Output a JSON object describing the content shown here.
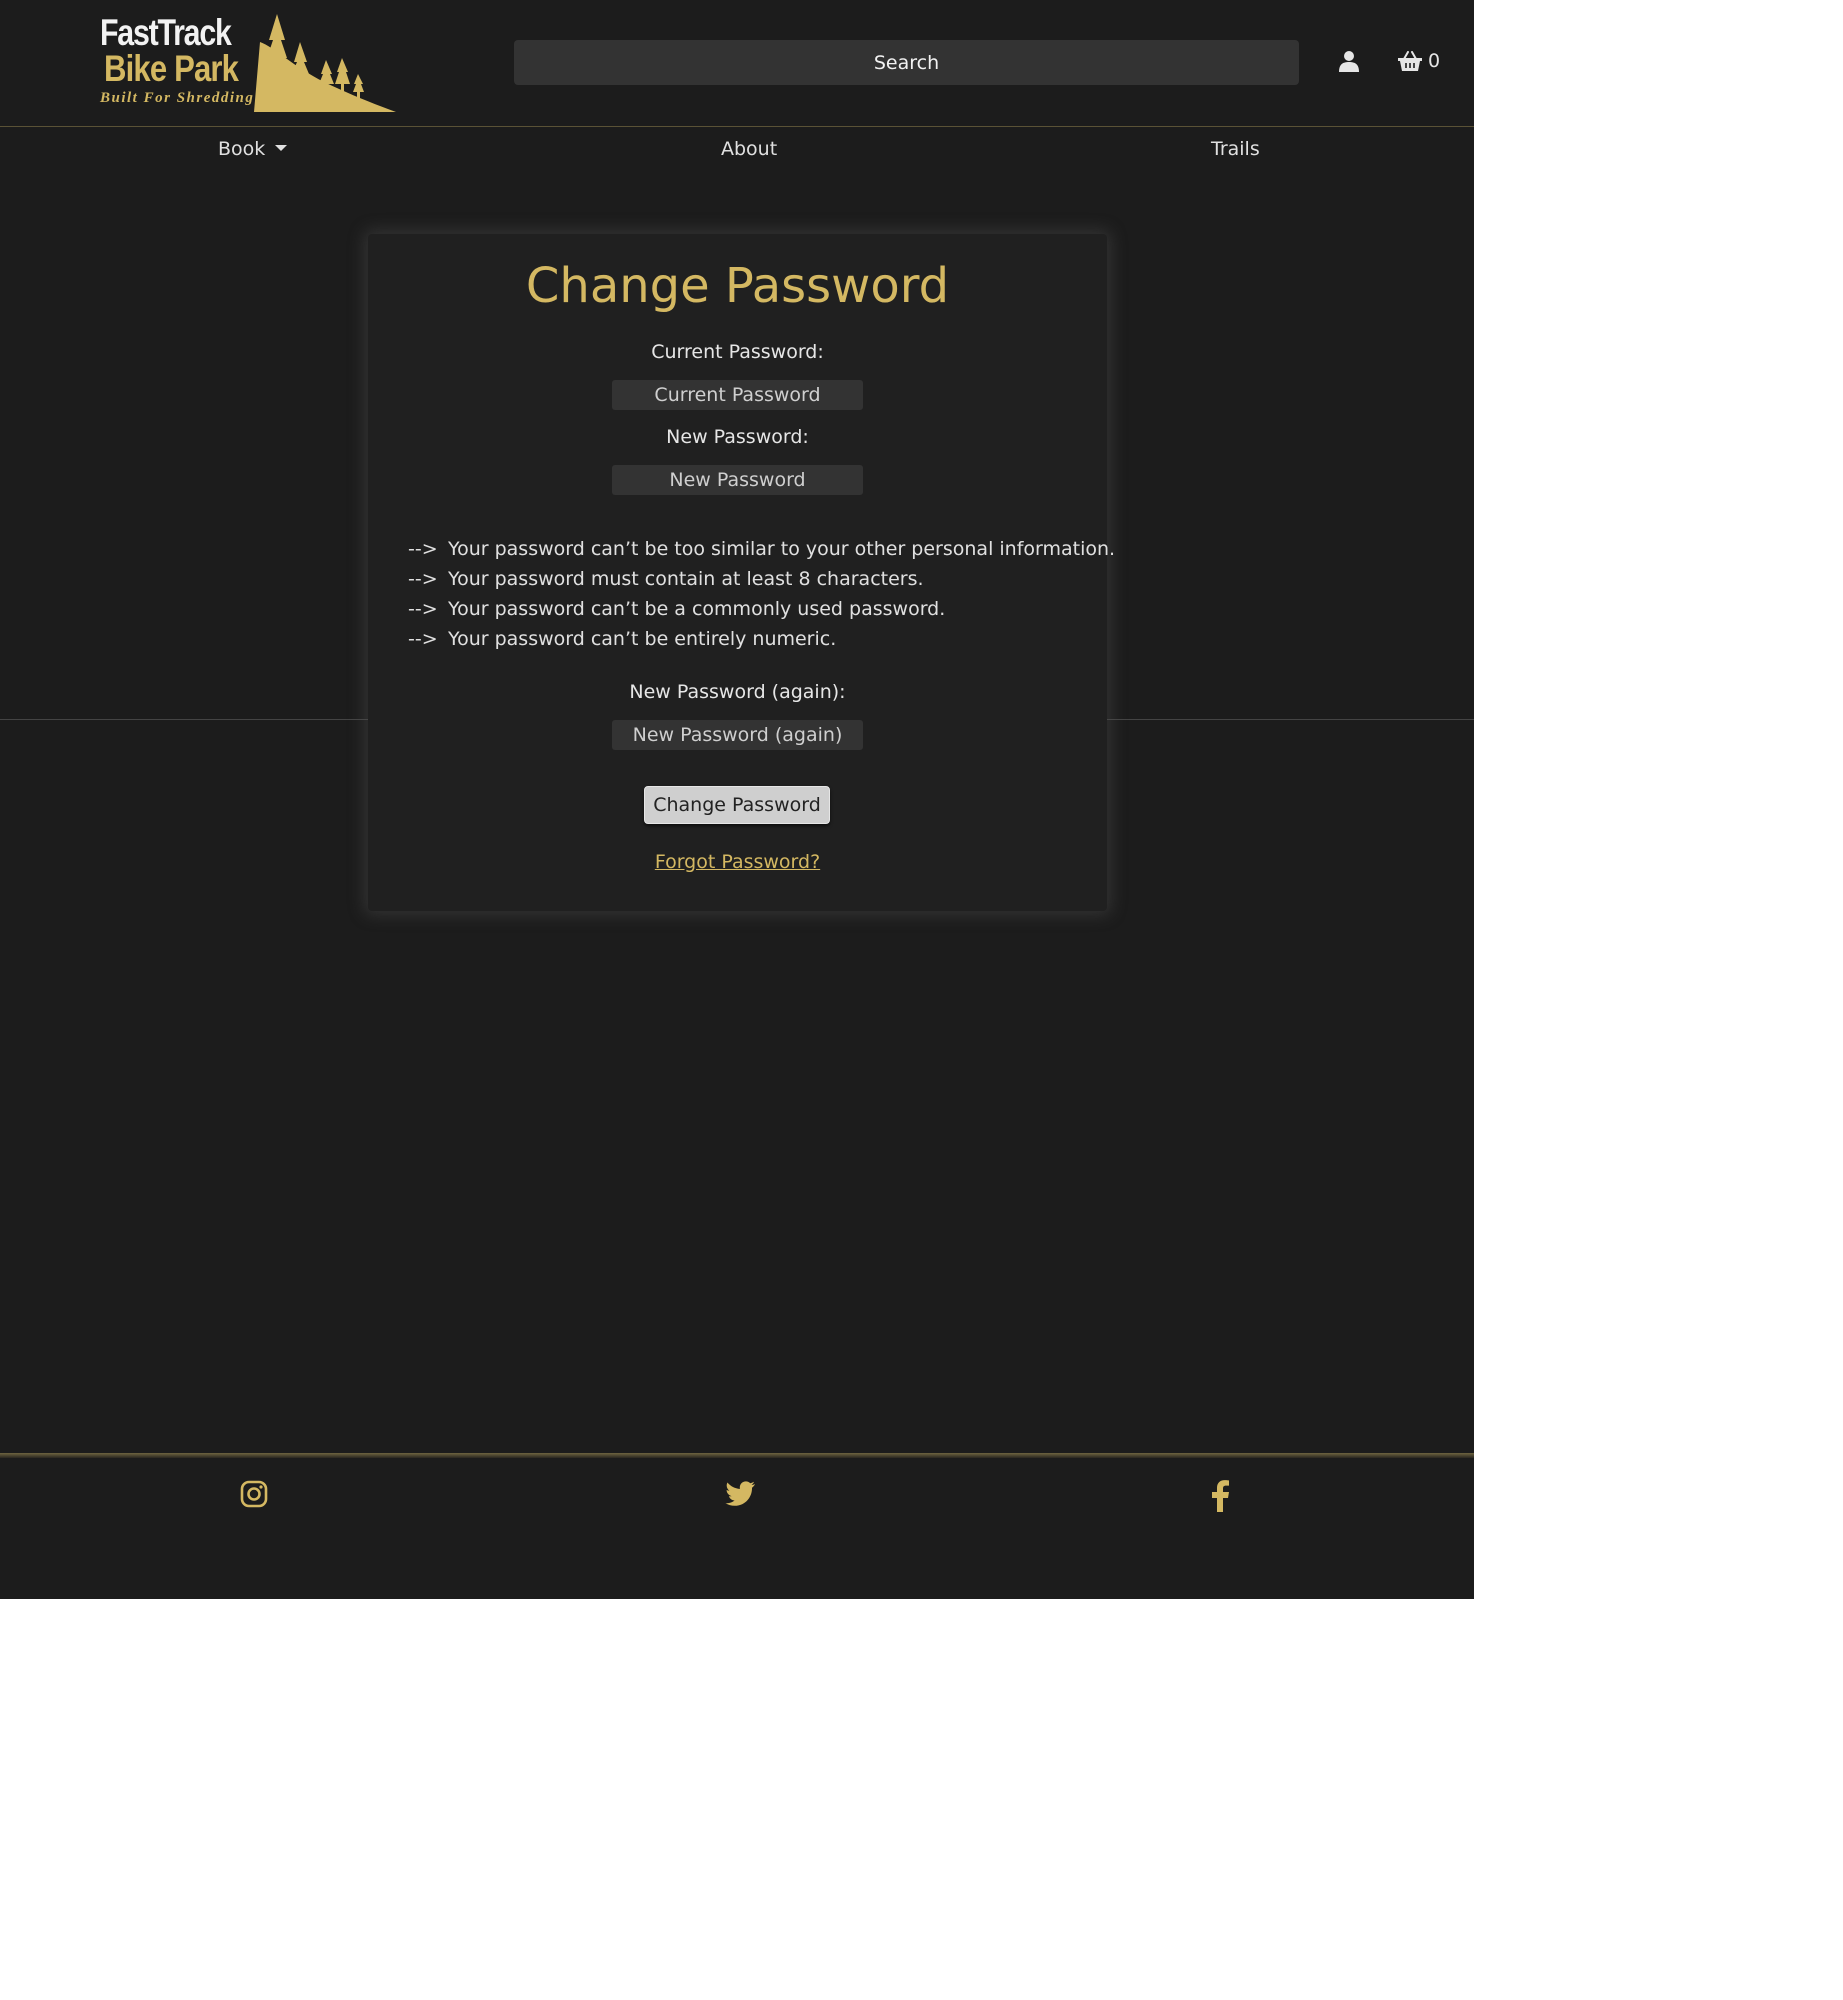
{
  "brand": {
    "line1": "FastTrack",
    "line2": "Bike Park",
    "tagline": "Built For Shredding",
    "accent_color": "#d4b862"
  },
  "header": {
    "search_placeholder": "Search",
    "account_icon": "user-icon",
    "cart_icon": "basket-icon",
    "cart_count": "0"
  },
  "nav": {
    "items": [
      {
        "label": "Book",
        "has_dropdown": true
      },
      {
        "label": "About"
      },
      {
        "label": "Trails"
      }
    ]
  },
  "form": {
    "title": "Change Password",
    "current_label": "Current Password:",
    "current_placeholder": "Current Password",
    "new_label": "New Password:",
    "new_placeholder": "New Password",
    "rules_marker": "-->",
    "rules": [
      "Your password can’t be too similar to your other personal information.",
      "Your password must contain at least 8 characters.",
      "Your password can’t be a commonly used password.",
      "Your password can’t be entirely numeric."
    ],
    "confirm_label": "New Password (again):",
    "confirm_placeholder": "New Password (again)",
    "submit_label": "Change Password",
    "forgot_link": "Forgot Password?"
  },
  "footer": {
    "social_icons": [
      "instagram-icon",
      "twitter-icon",
      "facebook-icon"
    ]
  }
}
